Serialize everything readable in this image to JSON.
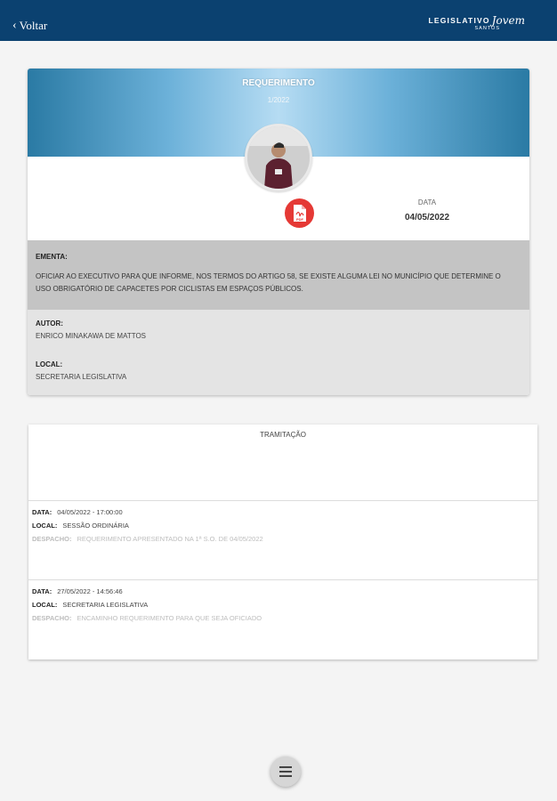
{
  "header": {
    "back_label": "Voltar",
    "brand_legislativo": "LEGISLATIVO",
    "brand_jovem": "Jovem",
    "brand_city": "SANTOS"
  },
  "document": {
    "type": "REQUERIMENTO",
    "number": "1/2022",
    "date_label": "DATA",
    "date_value": "04/05/2022",
    "pdf_label": "PDF",
    "ementa_label": "EMENTA:",
    "ementa_text": "OFICIAR AO EXECUTIVO PARA QUE INFORME, NOS TERMOS DO ARTIGO 58, SE EXISTE ALGUMA LEI NO MUNICÍPIO QUE DETERMINE O USO OBRIGATÓRIO DE CAPACETES POR CICLISTAS EM ESPAÇOS PÚBLICOS.",
    "autor_label": "AUTOR:",
    "autor_value": "ENRICO MINAKAWA DE MATTOS",
    "local_label": "LOCAL:",
    "local_value": "SECRETARIA LEGISLATIVA"
  },
  "tramitacao": {
    "title": "TRAMITAÇÃO",
    "data_label": "DATA:",
    "local_label": "LOCAL:",
    "despacho_label": "DESPACHO:",
    "entries": [
      {
        "data": "04/05/2022 - 17:00:00",
        "local": "SESSÃO ORDINÁRIA",
        "despacho": "REQUERIMENTO APRESENTADO NA 1ª S.O. DE 04/05/2022"
      },
      {
        "data": "27/05/2022 - 14:56:46",
        "local": "SECRETARIA LEGISLATIVA",
        "despacho": "ENCAMINHO REQUERIMENTO PARA QUE SEJA OFICIADO"
      }
    ]
  },
  "colors": {
    "topbar": "#0b4170",
    "pdf_button": "#e53935",
    "ementa_bg": "#c4c4c4",
    "info_bg": "#e4e4e4"
  },
  "icons": [
    "chevron-left-icon",
    "pdf-icon",
    "menu-icon",
    "author-photo"
  ]
}
